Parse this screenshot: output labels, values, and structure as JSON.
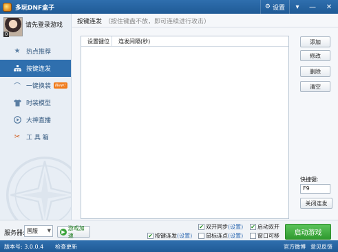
{
  "titlebar": {
    "title": "多玩DNF盒子",
    "settings_label": "设置",
    "icons": [
      "gear-icon",
      "menu-icon",
      "minimize-icon",
      "close-icon"
    ]
  },
  "user": {
    "login_prompt": "请先登录游戏",
    "avatar_number": "0"
  },
  "sidebar": {
    "items": [
      {
        "label": "热点推荐",
        "icon": "star-icon",
        "active": false
      },
      {
        "label": "按键连发",
        "icon": "org-chart-icon",
        "active": true
      },
      {
        "label": "一键换装",
        "icon": "hanger-icon",
        "active": false,
        "badge": "New!"
      },
      {
        "label": "时装模型",
        "icon": "shirt-icon",
        "active": false
      },
      {
        "label": "大神直播",
        "icon": "play-icon",
        "active": false
      },
      {
        "label": "工 具 箱",
        "icon": "tools-icon",
        "active": false
      }
    ]
  },
  "main": {
    "title": "按键连发",
    "hint": "（按住键盘不放，即可连续进行攻击）",
    "table": {
      "columns": [
        "设置键位",
        "连发间隔(秒)"
      ],
      "rows": []
    },
    "buttons": {
      "add": "添加",
      "edit": "修改",
      "delete": "删除",
      "clear": "清空",
      "close_burst": "关闭连发"
    },
    "hotkey_label": "快捷键:",
    "hotkey_value": "F9"
  },
  "bottom": {
    "server_label": "服务器:",
    "server_value": "国服",
    "accelerate_label": "游戏加速",
    "checkboxes": {
      "key_burst": {
        "label": "按键连发",
        "link": "(设置)",
        "checked": true
      },
      "dual_sync": {
        "label": "双开同步",
        "link": "(设置)",
        "checked": true
      },
      "mouse_click": {
        "label": "鼠标连点",
        "link": "(设置)",
        "checked": false
      },
      "dual_launch": {
        "label": "启动双开",
        "checked": true
      },
      "window_resizable": {
        "label": "窗口可移",
        "checked": false
      }
    },
    "start_label": "启动游戏"
  },
  "statusbar": {
    "version": "版本号: 3.0.0.4",
    "check_update": "检查更新",
    "weibo": "官方微博",
    "feedback": "意见反馈"
  },
  "colors": {
    "brand_blue": "#2f6fae",
    "start_green": "#3aa33a",
    "new_badge": "#f07a19"
  }
}
